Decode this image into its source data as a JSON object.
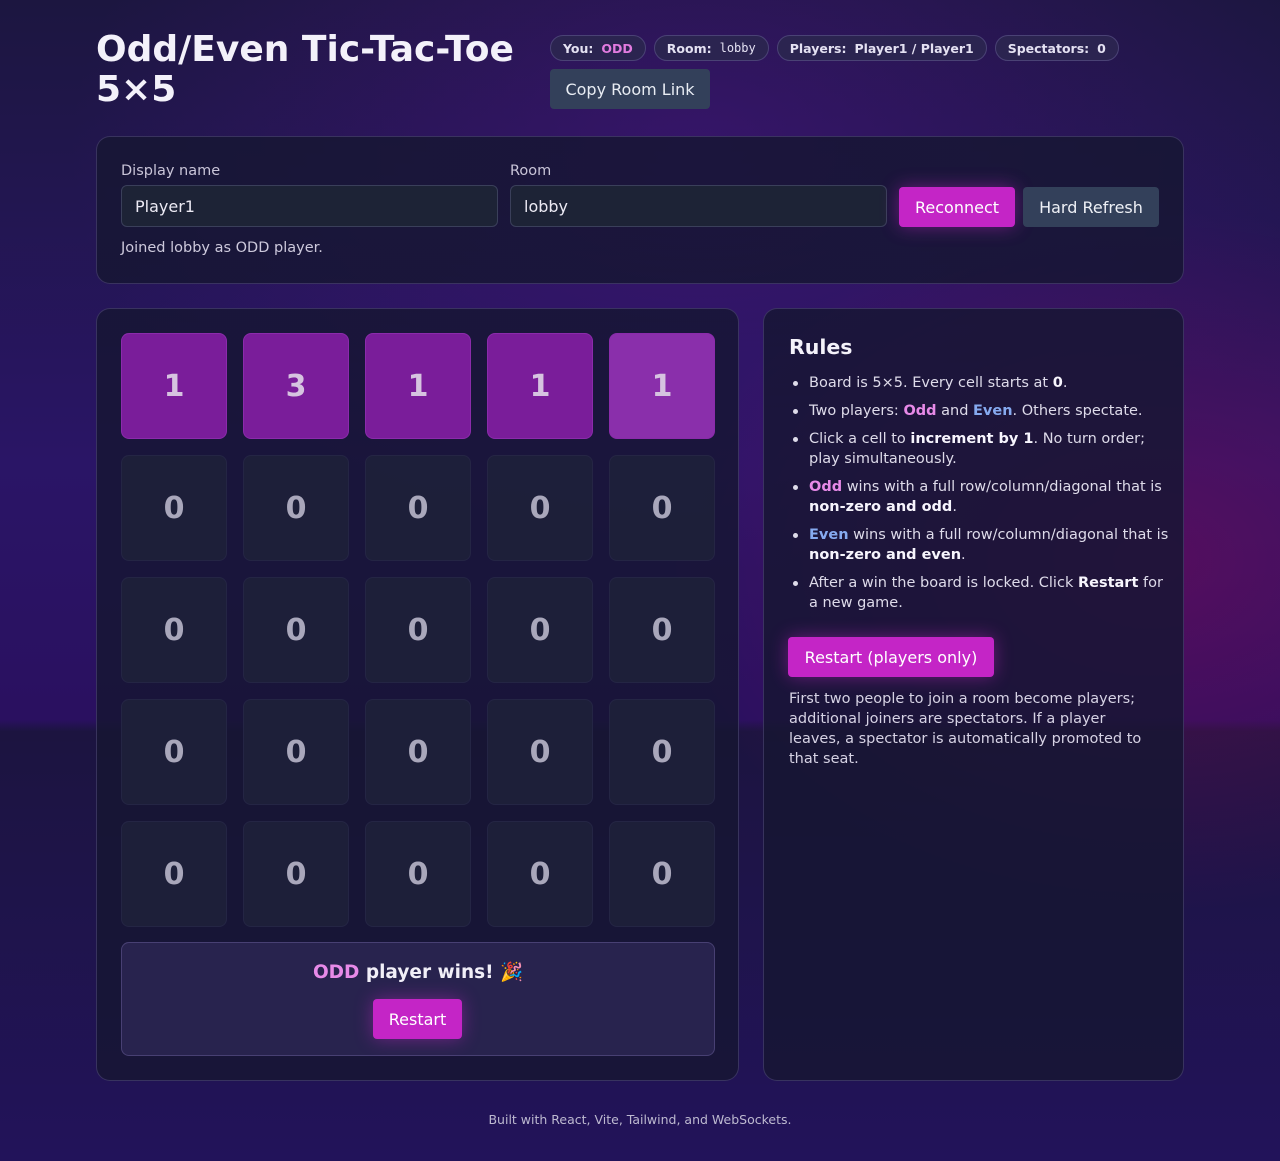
{
  "header": {
    "title_line1": "Odd/Even Tic-Tac-Toe",
    "title_line2": "5×5",
    "pills": {
      "you_label": "You:",
      "you_value": "ODD",
      "room_label": "Room:",
      "room_value": "lobby",
      "players_label": "Players:",
      "players_value": "Player1 / Player1",
      "spectators_label": "Spectators:",
      "spectators_value": "0"
    },
    "copy_link_label": "Copy Room Link"
  },
  "connection": {
    "display_name_label": "Display name",
    "display_name_value": "Player1",
    "room_label": "Room",
    "room_value": "lobby",
    "reconnect_label": "Reconnect",
    "hard_refresh_label": "Hard Refresh",
    "status": "Joined lobby as ODD player."
  },
  "board": {
    "cells": [
      [
        "1",
        "3",
        "1",
        "1",
        "1"
      ],
      [
        "0",
        "0",
        "0",
        "0",
        "0"
      ],
      [
        "0",
        "0",
        "0",
        "0",
        "0"
      ],
      [
        "0",
        "0",
        "0",
        "0",
        "0"
      ],
      [
        "0",
        "0",
        "0",
        "0",
        "0"
      ]
    ],
    "win": {
      "winner": "ODD",
      "message": " player wins! 🎉",
      "restart_label": "Restart"
    }
  },
  "rules": {
    "title": "Rules",
    "items": {
      "r1_text": "Board is 5×5. Every cell starts at ",
      "r1_bold": "0",
      "r1_end": ".",
      "r2_text": "Two players: ",
      "r2_odd": "Odd",
      "r2_and": " and ",
      "r2_even": "Even",
      "r2_end": ". Others spectate.",
      "r3_text": "Click a cell to ",
      "r3_bold": "increment by 1",
      "r3_end": ". No turn order; play simultaneously.",
      "r4_odd": "Odd",
      "r4_text": " wins with a full row/column/diagonal that is ",
      "r4_bold": "non-zero and odd",
      "r4_end": ".",
      "r5_even": "Even",
      "r5_text": " wins with a full row/column/diagonal that is ",
      "r5_bold": "non-zero and even",
      "r5_end": ".",
      "r6_text": "After a win the board is locked. Click ",
      "r6_bold": "Restart",
      "r6_end": " for a new game."
    },
    "restart_players_label": "Restart (players only)",
    "note": "First two people to join a room become players; additional joiners are spectators. If a player leaves, a spectator is automatically promoted to that seat."
  },
  "footer": "Built with React, Vite, Tailwind, and WebSockets."
}
